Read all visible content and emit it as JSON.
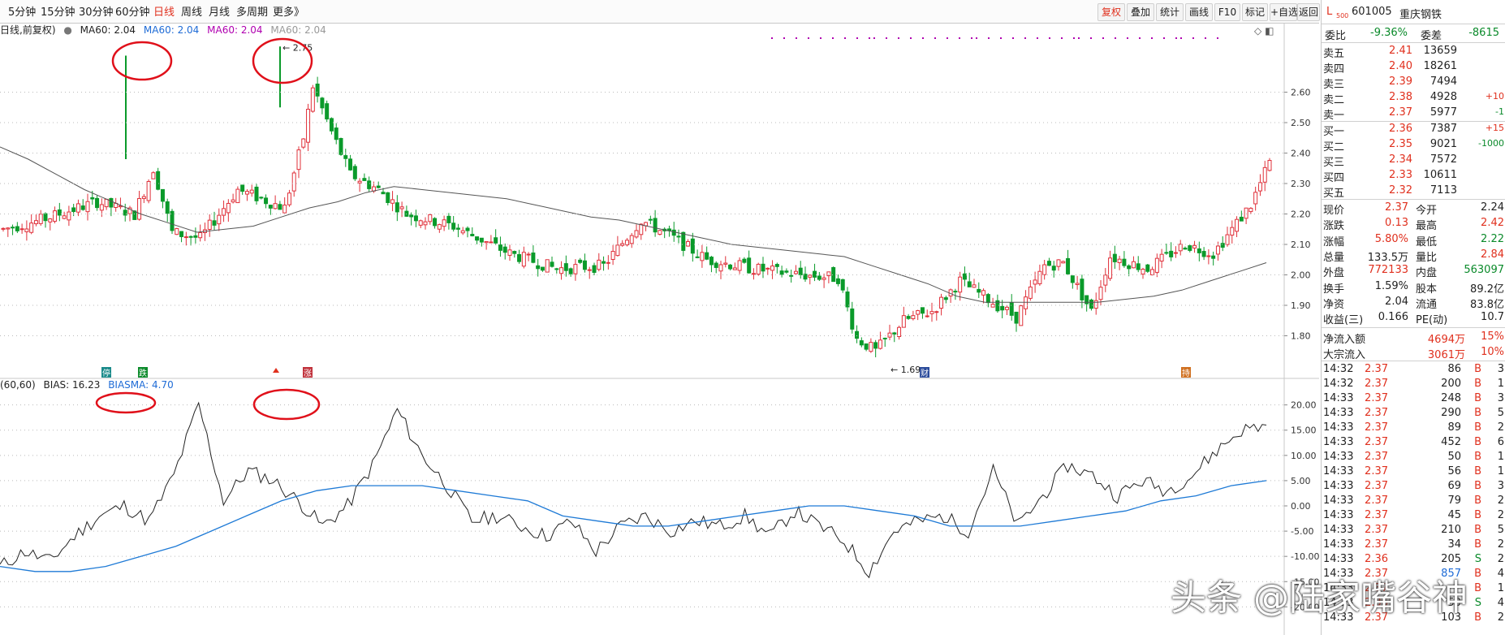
{
  "toolbar": {
    "periods": [
      "5分钟",
      "15分钟",
      "30分钟",
      "60分钟",
      "日线",
      "周线",
      "月线",
      "多周期",
      "更多》"
    ],
    "active_period": "日线",
    "buttons": [
      "复权",
      "叠加",
      "统计",
      "画线",
      "F10",
      "标记",
      "+自选",
      "返回"
    ],
    "active_button": "复权"
  },
  "ma_legend": {
    "prefix": "日线,前复权)",
    "items": [
      {
        "label": "MA60: 2.04",
        "color": "#222222"
      },
      {
        "label": "MA60: 2.04",
        "color": "#1e6bd6"
      },
      {
        "label": "MA60: 2.04",
        "color": "#b000b0"
      },
      {
        "label": "MA60: 2.04",
        "color": "#999999"
      }
    ]
  },
  "bias_legend": {
    "prefix": "(60,60)",
    "bias_label": "BIAS: 16.23",
    "biasma_label": "BIASMA: 4.70",
    "bias_color": "#222222",
    "biasma_color": "#1e6bd6"
  },
  "chart_data": [
    {
      "type": "candlestick",
      "y_ticks": [
        "2.60",
        "2.50",
        "2.40",
        "2.30",
        "2.20",
        "2.10",
        "2.00",
        "1.90",
        "1.80"
      ],
      "ylim": [
        1.66,
        2.78
      ],
      "annotations": [
        {
          "text": "2.75",
          "label": "high"
        },
        {
          "text": "1.69",
          "label": "low"
        }
      ],
      "event_markers": [
        {
          "text": "停",
          "color": "#1a8a8a"
        },
        {
          "text": "跌",
          "color": "#0a8a2a"
        },
        {
          "text": "涨",
          "color": "#c0303a"
        },
        {
          "text": "财",
          "color": "#2a4a9a"
        },
        {
          "text": "持",
          "color": "#d07020"
        }
      ],
      "series": [
        {
          "name": "MA60",
          "values": [
            2.42,
            2.38,
            2.33,
            2.28,
            2.24,
            2.2,
            2.17,
            2.14,
            2.15,
            2.16,
            2.19,
            2.22,
            2.24,
            2.27,
            2.29,
            2.28,
            2.27,
            2.26,
            2.25,
            2.23,
            2.21,
            2.19,
            2.18,
            2.16,
            2.14,
            2.12,
            2.1,
            2.09,
            2.08,
            2.07,
            2.06,
            2.03,
            2.0,
            1.97,
            1.93,
            1.91,
            1.91,
            1.91,
            1.91,
            1.91,
            1.92,
            1.93,
            1.95,
            1.98,
            2.01,
            2.04
          ]
        }
      ]
    },
    {
      "type": "line",
      "y_ticks": [
        "20.00",
        "15.00",
        "10.00",
        "5.00",
        "0.00",
        "-5.00",
        "-10.00",
        "-15.00",
        "-20.00"
      ],
      "ylim": [
        -23,
        23
      ],
      "series": [
        {
          "name": "BIAS",
          "values": [
            -12,
            -9,
            -11,
            -6,
            -2,
            0,
            -3,
            6,
            20,
            1,
            7,
            5,
            1,
            -4,
            0,
            8,
            19,
            10,
            4,
            -3,
            -2,
            -4,
            -6,
            -3,
            -9,
            -4,
            -2,
            -5,
            -3,
            -4,
            -2,
            -6,
            -1,
            -4,
            -7,
            -13,
            -5,
            -3,
            -2,
            -5,
            7,
            -4,
            2,
            8,
            6,
            2,
            5,
            3,
            6,
            11,
            15,
            16
          ]
        },
        {
          "name": "BIASMA",
          "values": [
            -12,
            -13,
            -13,
            -12,
            -10,
            -8,
            -5,
            -2,
            1,
            3,
            4,
            4,
            4,
            3,
            2,
            1,
            -2,
            -3,
            -4,
            -4,
            -3,
            -2,
            -1,
            0,
            0,
            -1,
            -2,
            -4,
            -4,
            -4,
            -3,
            -2,
            -1,
            1,
            2,
            4,
            5
          ]
        }
      ]
    }
  ],
  "quote": {
    "header_prefix": "L",
    "header_sub": "500",
    "code": "601005",
    "name": "重庆钢铁",
    "weibi_label": "委比",
    "weibi": "-9.36%",
    "weicha_label": "委差",
    "weicha": "-8615",
    "sells": [
      {
        "label": "卖五",
        "price": "2.41",
        "vol": "13659",
        "chg": ""
      },
      {
        "label": "卖四",
        "price": "2.40",
        "vol": "18261",
        "chg": ""
      },
      {
        "label": "卖三",
        "price": "2.39",
        "vol": "7494",
        "chg": ""
      },
      {
        "label": "卖二",
        "price": "2.38",
        "vol": "4928",
        "chg": "+10"
      },
      {
        "label": "卖一",
        "price": "2.37",
        "vol": "5977",
        "chg": "-1"
      }
    ],
    "buys": [
      {
        "label": "买一",
        "price": "2.36",
        "vol": "7387",
        "chg": "+15"
      },
      {
        "label": "买二",
        "price": "2.35",
        "vol": "9021",
        "chg": "-1000"
      },
      {
        "label": "买三",
        "price": "2.34",
        "vol": "7572",
        "chg": ""
      },
      {
        "label": "买四",
        "price": "2.33",
        "vol": "10611",
        "chg": ""
      },
      {
        "label": "买五",
        "price": "2.32",
        "vol": "7113",
        "chg": ""
      }
    ],
    "stats": [
      {
        "l1": "现价",
        "v1": "2.37",
        "c1": "up",
        "l2": "今开",
        "v2": "2.24",
        "c2": ""
      },
      {
        "l1": "涨跌",
        "v1": "0.13",
        "c1": "up",
        "l2": "最高",
        "v2": "2.42",
        "c2": "up"
      },
      {
        "l1": "涨幅",
        "v1": "5.80%",
        "c1": "up",
        "l2": "最低",
        "v2": "2.22",
        "c2": "dn"
      },
      {
        "l1": "总量",
        "v1": "133.5万",
        "c1": "",
        "l2": "量比",
        "v2": "2.84",
        "c2": "up"
      },
      {
        "l1": "外盘",
        "v1": "772133",
        "c1": "up",
        "l2": "内盘",
        "v2": "563097",
        "c2": "dn"
      },
      {
        "l1": "换手",
        "v1": "1.59%",
        "c1": "",
        "l2": "股本",
        "v2": "89.2亿",
        "c2": ""
      },
      {
        "l1": "净资",
        "v1": "2.04",
        "c1": "",
        "l2": "流通",
        "v2": "83.8亿",
        "c2": ""
      },
      {
        "l1": "收益(三)",
        "v1": "0.166",
        "c1": "",
        "l2": "PE(动)",
        "v2": "10.7",
        "c2": ""
      }
    ],
    "flows": [
      {
        "label": "净流入额",
        "value": "4694万",
        "pct": "15%"
      },
      {
        "label": "大宗流入",
        "value": "3061万",
        "pct": "10%"
      }
    ],
    "ticks": [
      {
        "time": "14:32",
        "price": "2.37",
        "vol": "86",
        "bs": "B",
        "n": "3",
        "pc": "up",
        "vc": ""
      },
      {
        "time": "14:32",
        "price": "2.37",
        "vol": "200",
        "bs": "B",
        "n": "1",
        "pc": "up",
        "vc": ""
      },
      {
        "time": "14:33",
        "price": "2.37",
        "vol": "248",
        "bs": "B",
        "n": "3",
        "pc": "up",
        "vc": ""
      },
      {
        "time": "14:33",
        "price": "2.37",
        "vol": "290",
        "bs": "B",
        "n": "5",
        "pc": "up",
        "vc": ""
      },
      {
        "time": "14:33",
        "price": "2.37",
        "vol": "89",
        "bs": "B",
        "n": "2",
        "pc": "up",
        "vc": ""
      },
      {
        "time": "14:33",
        "price": "2.37",
        "vol": "452",
        "bs": "B",
        "n": "6",
        "pc": "up",
        "vc": ""
      },
      {
        "time": "14:33",
        "price": "2.37",
        "vol": "50",
        "bs": "B",
        "n": "1",
        "pc": "up",
        "vc": ""
      },
      {
        "time": "14:33",
        "price": "2.37",
        "vol": "56",
        "bs": "B",
        "n": "1",
        "pc": "up",
        "vc": ""
      },
      {
        "time": "14:33",
        "price": "2.37",
        "vol": "69",
        "bs": "B",
        "n": "3",
        "pc": "up",
        "vc": ""
      },
      {
        "time": "14:33",
        "price": "2.37",
        "vol": "79",
        "bs": "B",
        "n": "2",
        "pc": "up",
        "vc": ""
      },
      {
        "time": "14:33",
        "price": "2.37",
        "vol": "45",
        "bs": "B",
        "n": "2",
        "pc": "up",
        "vc": ""
      },
      {
        "time": "14:33",
        "price": "2.37",
        "vol": "210",
        "bs": "B",
        "n": "5",
        "pc": "up",
        "vc": ""
      },
      {
        "time": "14:33",
        "price": "2.37",
        "vol": "34",
        "bs": "B",
        "n": "2",
        "pc": "up",
        "vc": ""
      },
      {
        "time": "14:33",
        "price": "2.36",
        "vol": "205",
        "bs": "S",
        "n": "2",
        "pc": "up",
        "vc": ""
      },
      {
        "time": "14:33",
        "price": "2.37",
        "vol": "857",
        "bs": "B",
        "n": "4",
        "pc": "up",
        "vc": "bl"
      },
      {
        "time": "14:33",
        "price": "2.37",
        "vol": "",
        "bs": "B",
        "n": "1",
        "pc": "up",
        "vc": ""
      },
      {
        "time": "14:33",
        "price": "2.36",
        "vol": "50",
        "bs": "S",
        "n": "4",
        "pc": "up",
        "vc": ""
      },
      {
        "time": "14:33",
        "price": "2.37",
        "vol": "103",
        "bs": "B",
        "n": "2",
        "pc": "up",
        "vc": ""
      }
    ]
  },
  "watermark": "头条 @陆家嘴谷神"
}
